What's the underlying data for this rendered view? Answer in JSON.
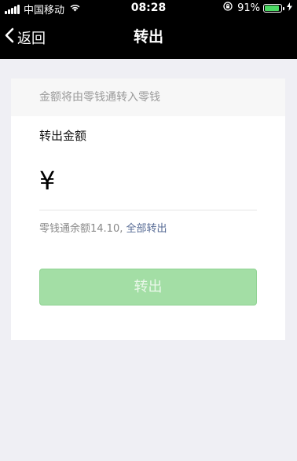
{
  "status_bar": {
    "carrier": "中国移动",
    "time": "08:28",
    "battery_percent": "91%",
    "battery_level": 0.91,
    "icons": [
      "signal-icon",
      "wifi-icon",
      "orientation-lock-icon",
      "battery-icon",
      "charging-icon"
    ]
  },
  "nav": {
    "back_label": "返回",
    "title": "转出"
  },
  "form": {
    "notice": "金额将由零钱通转入零钱",
    "amount_label": "转出金额",
    "currency_symbol": "¥",
    "amount_value": "",
    "balance_prefix": "零钱通余额14.10, ",
    "withdraw_all_label": "全部转出",
    "submit_label": "转出"
  },
  "colors": {
    "nav_background": "#000000",
    "page_background": "#efeff4",
    "link": "#576b95",
    "button_disabled": "#a3dea5",
    "battery": "#4cd964"
  }
}
